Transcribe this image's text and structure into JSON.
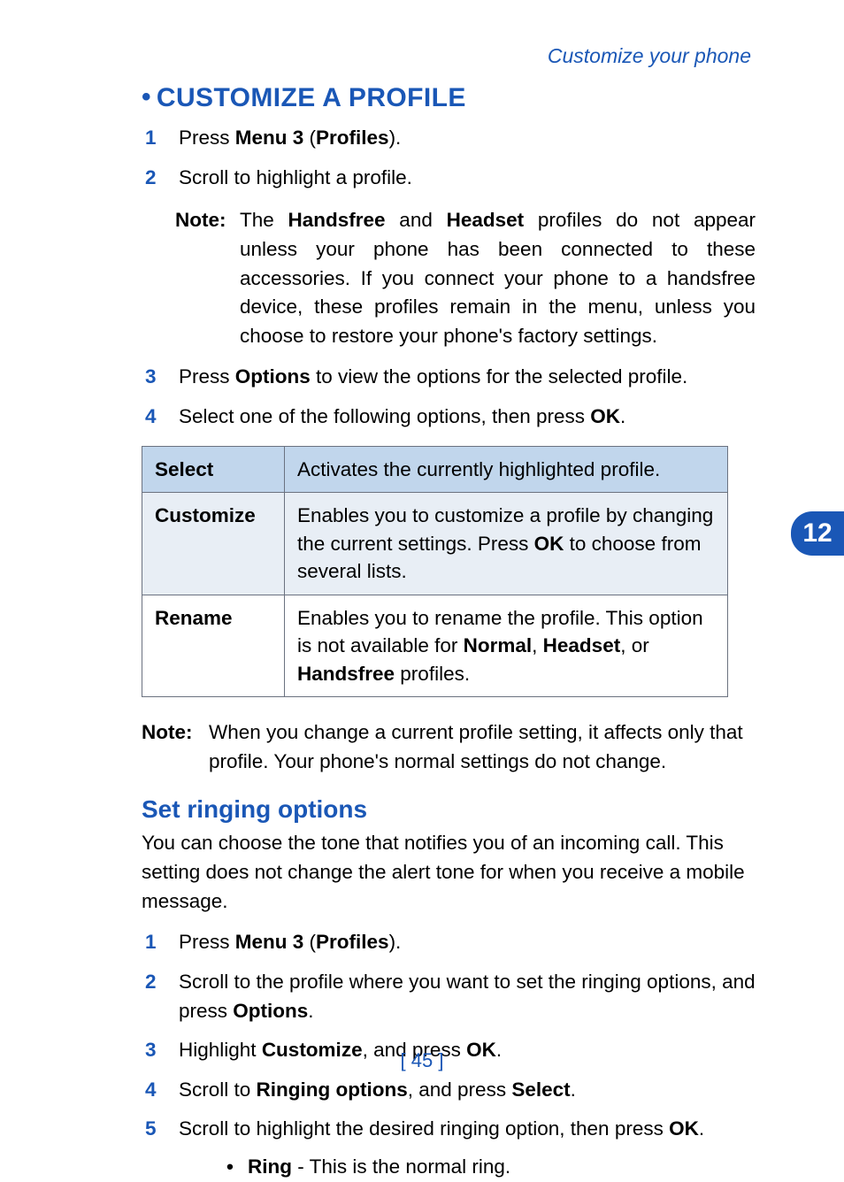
{
  "header": "Customize your phone",
  "h1": "CUSTOMIZE A PROFILE",
  "chapter_tab": "12",
  "page_number": "[ 45 ]",
  "steps1": {
    "s1_pre": "Press ",
    "s1_bold": "Menu 3",
    "s1_paren": " (",
    "s1_bold2": "Profiles",
    "s1_end": ").",
    "s2": "Scroll to highlight a profile.",
    "s3_pre": "Press ",
    "s3_bold": "Options",
    "s3_post": " to view the options for the selected profile.",
    "s4_pre": "Select one of the following options, then press ",
    "s4_bold": "OK",
    "s4_post": "."
  },
  "note1": {
    "label": "Note:",
    "pre": "The ",
    "b1": "Handsfree",
    "mid1": " and ",
    "b2": "Headset",
    "rest": " profiles do not appear unless your phone has been connected to these accessories. If you connect your phone to a handsfree device, these profiles remain in the menu, unless you choose to restore your phone's factory settings."
  },
  "table": {
    "r1c1": "Select",
    "r1c2": "Activates the currently highlighted profile.",
    "r2c1": "Customize",
    "r2c2_pre": "Enables you to customize a profile by changing the current settings. Press ",
    "r2c2_b": "OK",
    "r2c2_post": " to choose from several lists.",
    "r3c1": "Rename",
    "r3c2_pre": "Enables you to rename the profile. This option is not available for ",
    "r3c2_b1": "Normal",
    "r3c2_m1": ", ",
    "r3c2_b2": "Headset",
    "r3c2_m2": ", or ",
    "r3c2_b3": "Handsfree",
    "r3c2_post": " profiles."
  },
  "note2": {
    "label": "Note:",
    "text": "When you change a current profile setting, it affects only that profile. Your phone's normal settings do not change."
  },
  "h2": "Set ringing options",
  "para2": "You can choose the tone that notifies you of an incoming call. This setting does not change the alert tone for when you receive a mobile message.",
  "steps2": {
    "s1_pre": "Press ",
    "s1_b1": "Menu 3",
    "s1_m": " (",
    "s1_b2": "Profiles",
    "s1_end": ").",
    "s2_pre": "Scroll to the profile where you want to set the ringing options, and press ",
    "s2_b": "Options",
    "s2_post": ".",
    "s3_pre": "Highlight ",
    "s3_b1": "Customize",
    "s3_m": ", and press ",
    "s3_b2": "OK",
    "s3_post": ".",
    "s4_pre": "Scroll to ",
    "s4_b1": "Ringing options",
    "s4_m": ", and press ",
    "s4_b2": "Select",
    "s4_post": ".",
    "s5_pre": "Scroll to highlight the desired ringing option, then press ",
    "s5_b": "OK",
    "s5_post": "."
  },
  "sub": {
    "b": "Ring",
    "rest": " - This is the normal ring."
  }
}
